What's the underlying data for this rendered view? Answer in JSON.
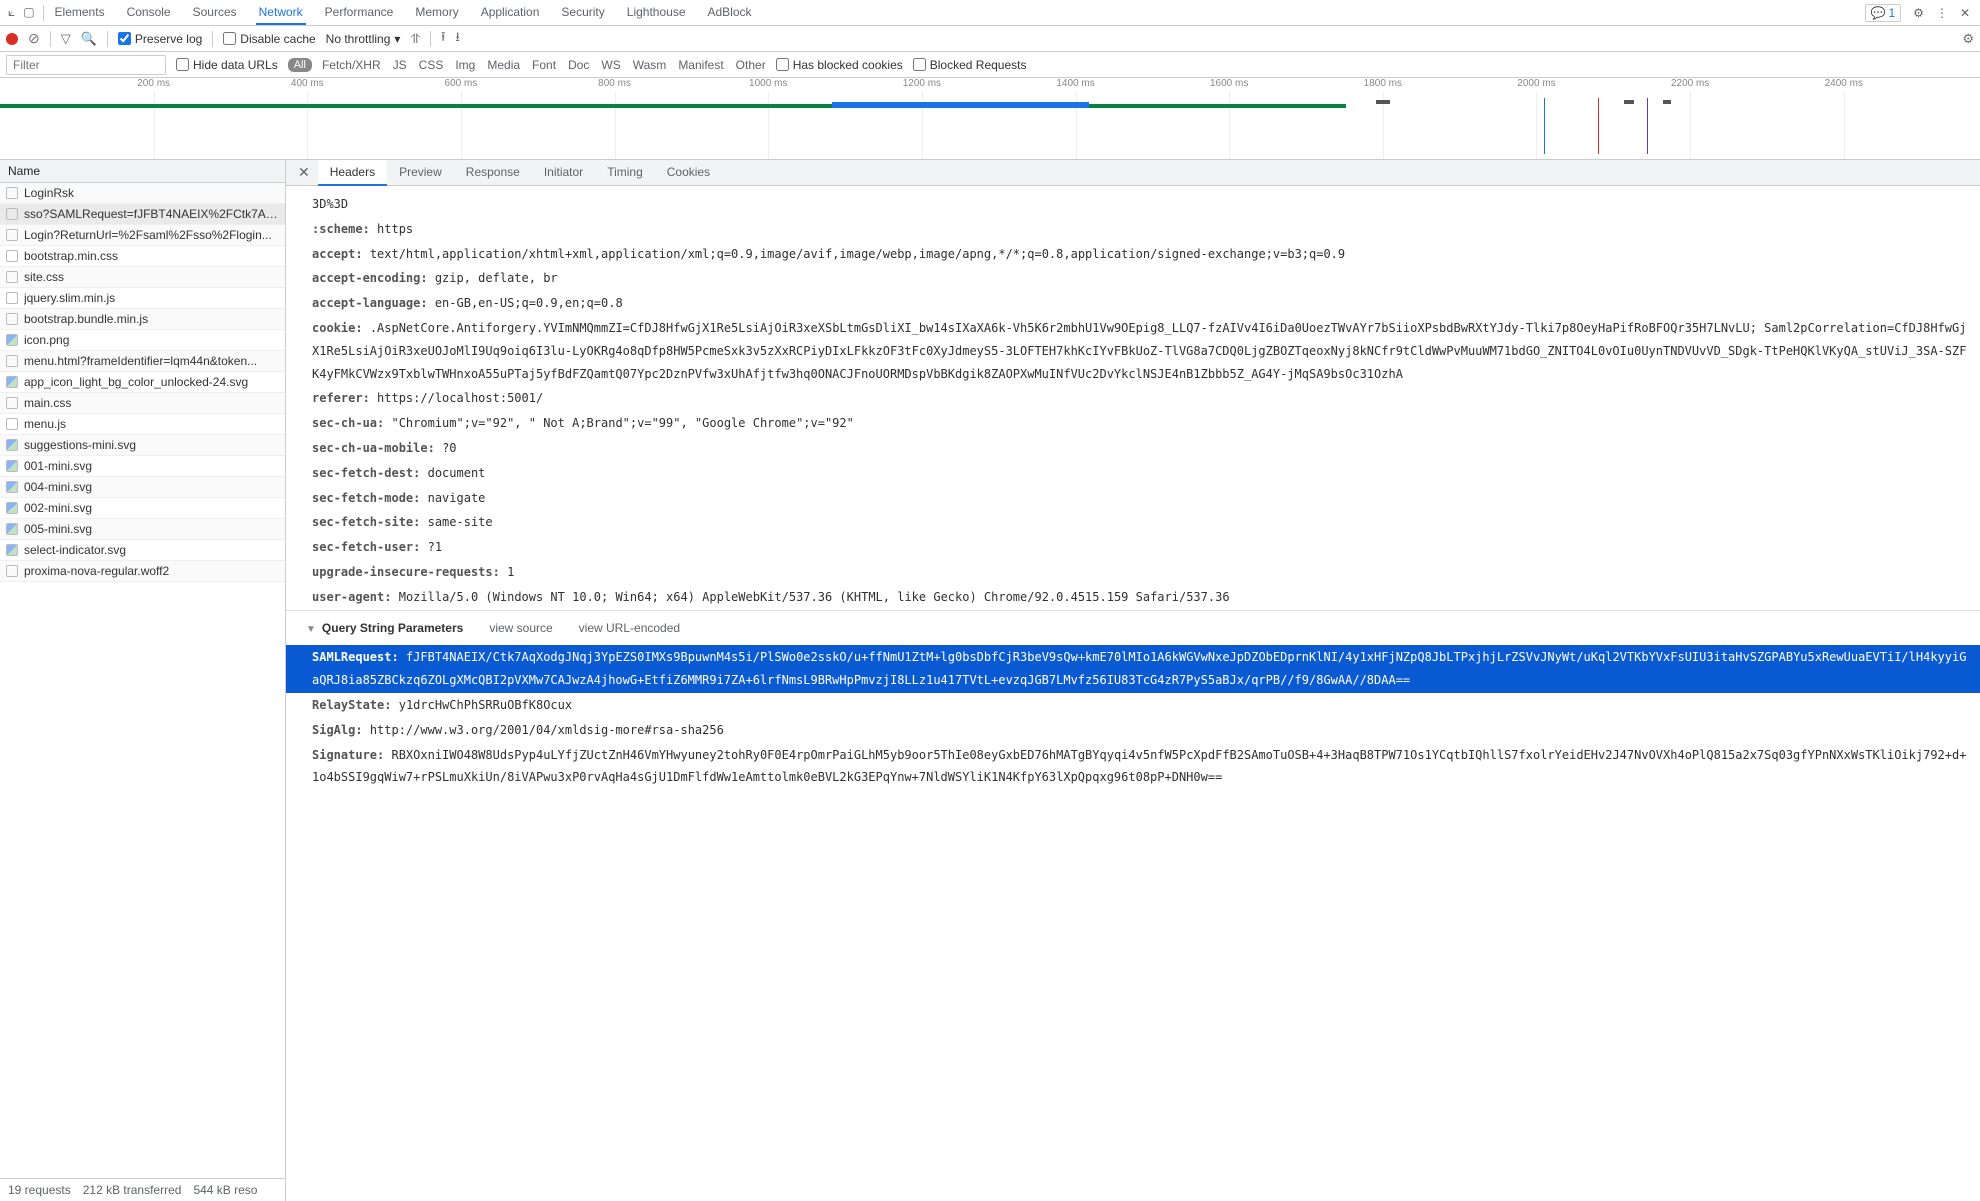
{
  "topTabs": [
    "Elements",
    "Console",
    "Sources",
    "Network",
    "Performance",
    "Memory",
    "Application",
    "Security",
    "Lighthouse",
    "AdBlock"
  ],
  "topTabsActive": "Network",
  "msgCount": "1",
  "toolbar": {
    "preserve": "Preserve log",
    "disable": "Disable cache",
    "throttle": "No throttling"
  },
  "filter": {
    "placeholder": "Filter",
    "hideUrls": "Hide data URLs",
    "all": "All",
    "types": [
      "Fetch/XHR",
      "JS",
      "CSS",
      "Img",
      "Media",
      "Font",
      "Doc",
      "WS",
      "Wasm",
      "Manifest",
      "Other"
    ],
    "blockedCookies": "Has blocked cookies",
    "blockedReq": "Blocked Requests"
  },
  "timeline": {
    "ticks": [
      "200 ms",
      "400 ms",
      "600 ms",
      "800 ms",
      "1000 ms",
      "1200 ms",
      "1400 ms",
      "1600 ms",
      "1800 ms",
      "2000 ms",
      "2200 ms",
      "2400 ms"
    ]
  },
  "nameHeader": "Name",
  "requests": [
    "LoginRsk",
    "sso?SAMLRequest=fJFBT4NAEIX%2FCtk7Aq...",
    "Login?ReturnUrl=%2Fsaml%2Fsso%2Flogin...",
    "bootstrap.min.css",
    "site.css",
    "jquery.slim.min.js",
    "bootstrap.bundle.min.js",
    "icon.png",
    "menu.html?frameIdentifier=lqm44n&token...",
    "app_icon_light_bg_color_unlocked-24.svg",
    "main.css",
    "menu.js",
    "suggestions-mini.svg",
    "001-mini.svg",
    "004-mini.svg",
    "002-mini.svg",
    "005-mini.svg",
    "select-indicator.svg",
    "proxima-nova-regular.woff2"
  ],
  "requestsSelected": 1,
  "imgRows": [
    7,
    9,
    12,
    13,
    14,
    15,
    16,
    17
  ],
  "status": {
    "requests": "19 requests",
    "transferred": "212 kB transferred",
    "resources": "544 kB reso"
  },
  "detailTabs": [
    "Headers",
    "Preview",
    "Response",
    "Initiator",
    "Timing",
    "Cookies"
  ],
  "detailTabsActive": "Headers",
  "headers": [
    {
      "k": "",
      "v": "3D%3D"
    },
    {
      "k": ":scheme:",
      "v": "https"
    },
    {
      "k": "accept:",
      "v": "text/html,application/xhtml+xml,application/xml;q=0.9,image/avif,image/webp,image/apng,*/*;q=0.8,application/signed-exchange;v=b3;q=0.9"
    },
    {
      "k": "accept-encoding:",
      "v": "gzip, deflate, br"
    },
    {
      "k": "accept-language:",
      "v": "en-GB,en-US;q=0.9,en;q=0.8"
    },
    {
      "k": "cookie:",
      "v": ".AspNetCore.Antiforgery.YVImNMQmmZI=CfDJ8HfwGjX1Re5LsiAjOiR3xeXSbLtmGsDliXI_bw14sIXaXA6k-Vh5K6r2mbhU1Vw9OEpig8_LLQ7-fzAIVv4I6iDa0UoezTWvAYr7bSiioXPsbdBwRXtYJdy-Tlki7p8OeyHaPifRoBFOQr35H7LNvLU; Saml2pCorrelation=CfDJ8HfwGjX1Re5LsiAjOiR3xeUOJoMlI9Uq9oiq6I3lu-LyOKRg4o8qDfp8HW5PcmeSxk3v5zXxRCPiyDIxLFkkzOF3tFc0XyJdmeyS5-3LOFTEH7khKcIYvFBkUoZ-TlVG8a7CDQ0LjgZBOZTqeoxNyj8kNCfr9tCldWwPvMuuWM71bdGO_ZNITO4L0vOIu0UynTNDVUvVD_SDgk-TtPeHQKlVKyQA_stUViJ_3SA-SZFK4yFMkCVWzx9TxblwTWHnxoA55uPTaj5yfBdFZQamtQ07Ypc2DznPVfw3xUhAfjtfw3hq0ONACJFnoUORMDspVbBKdgik8ZAOPXwMuINfVUc2DvYkclNSJE4nB1Zbbb5Z_AG4Y-jMqSA9bsOc31OzhA"
    },
    {
      "k": "referer:",
      "v": "https://localhost:5001/"
    },
    {
      "k": "sec-ch-ua:",
      "v": "\"Chromium\";v=\"92\", \" Not A;Brand\";v=\"99\", \"Google Chrome\";v=\"92\""
    },
    {
      "k": "sec-ch-ua-mobile:",
      "v": "?0"
    },
    {
      "k": "sec-fetch-dest:",
      "v": "document"
    },
    {
      "k": "sec-fetch-mode:",
      "v": "navigate"
    },
    {
      "k": "sec-fetch-site:",
      "v": "same-site"
    },
    {
      "k": "sec-fetch-user:",
      "v": "?1"
    },
    {
      "k": "upgrade-insecure-requests:",
      "v": "1"
    },
    {
      "k": "user-agent:",
      "v": "Mozilla/5.0 (Windows NT 10.0; Win64; x64) AppleWebKit/537.36 (KHTML, like Gecko) Chrome/92.0.4515.159 Safari/537.36"
    }
  ],
  "paramSection": {
    "title": "Query String Parameters",
    "viewSource": "view source",
    "viewEncoded": "view URL-encoded"
  },
  "params": [
    {
      "k": "SAMLRequest:",
      "v": "fJFBT4NAEIX/Ctk7AqXodgJNqj3YpEZS0IMXs9BpuwnM4s5i/PlSWo0e2sskO/u+ffNmU1ZtM+lg0bsDbfCjR3beV9sQw+kmE70lMIo1A6kWGVwNxeJpDZObEDprnKlNI/4y1xHFjNZpQ8JbLTPxjhjLrZSVvJNyWt/uKql2VTKbYVxFsUIU3itaHvSZGPABYu5xRewUuaEVTiI/lH4kyyiGaQRJ8ia85ZBCkzq6ZOLgXMcQBI2pVXMw7CAJwzA4jhowG+EtfiZ6MMR9i7ZA+6lrfNmsL9BRwHpPmvzjI8LLz1u417TVtL+evzqJGB7LMvfz56IU83TcG4zR7PyS5aBJx/qrPB//f9/8GwAA//8DAA==",
      "sel": true
    },
    {
      "k": "RelayState:",
      "v": "y1drcHwChPhSRRuOBfK8Ocux"
    },
    {
      "k": "SigAlg:",
      "v": "http://www.w3.org/2001/04/xmldsig-more#rsa-sha256"
    },
    {
      "k": "Signature:",
      "v": "RBXOxniIWO48W8UdsPyp4uLYfjZUctZnH46VmYHwyuney2tohRy0F0E4rpOmrPaiGLhM5yb9oor5ThIe08eyGxbED76hMATgBYqyqi4v5nfW5PcXpdFfB2SAmoTuOSB+4+3HaqB8TPW71Os1YCqtbIQhllS7fxolrYeidEHv2J47NvOVXh4oPlQ815a2x7Sq03gfYPnNXxWsTKliOikj792+d+1o4bSSI9gqWiw7+rPSLmuXkiUn/8iVAPwu3xP0rvAqHa4sGjU1DmFlfdWw1eAmttolmk0eBVL2kG3EPqYnw+7NldWSYliK1N4KfpY63lXpQpqxg96t08pP+DNH0w=="
    }
  ]
}
